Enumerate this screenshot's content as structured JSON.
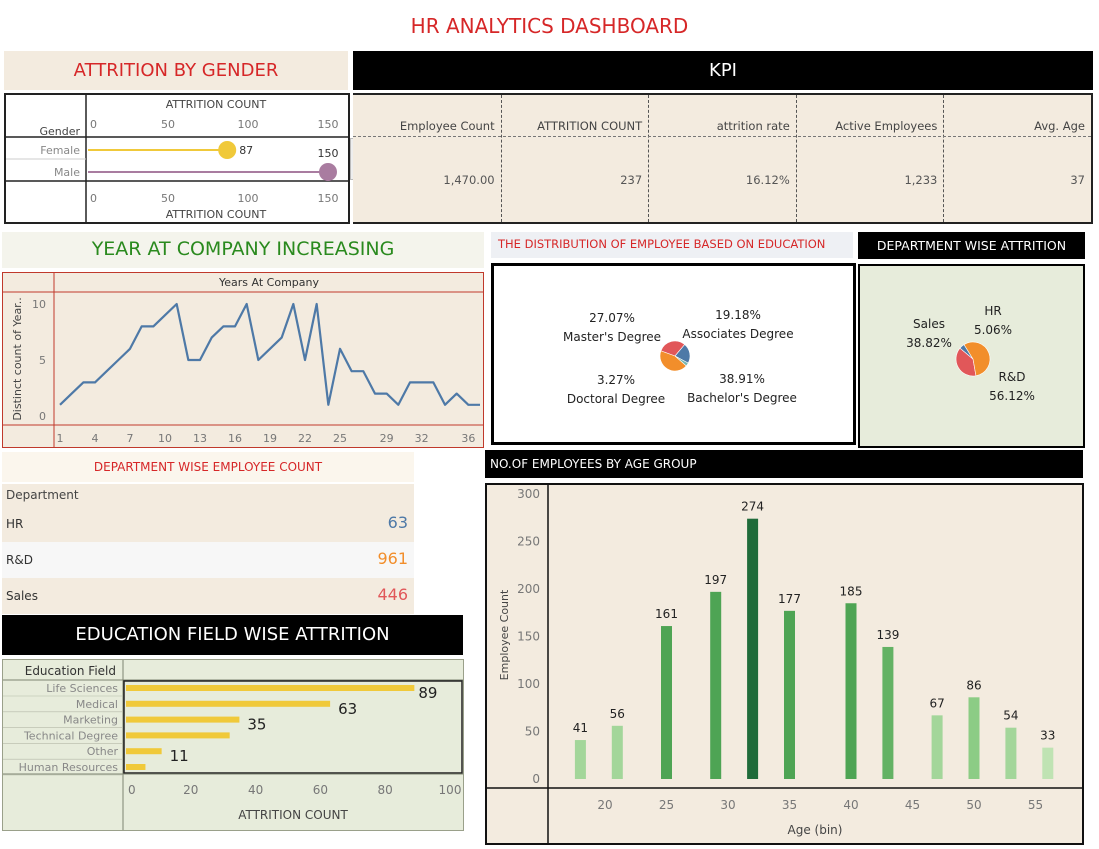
{
  "dashboard_title": "HR ANALYTICS DASHBOARD",
  "attrition_gender": {
    "title": "ATTRITION BY GENDER",
    "dim_label": "Gender",
    "axis_title": "ATTRITION COUNT",
    "ticks": [
      "0",
      "50",
      "100",
      "150"
    ],
    "rows": [
      {
        "label": "Female",
        "value": 87,
        "value_label": "87",
        "color": "#f0c93a"
      },
      {
        "label": "Male",
        "value": 150,
        "value_label": "150",
        "color": "#a97ca0"
      }
    ]
  },
  "kpi": {
    "title": "KPI",
    "items": [
      {
        "label": "Employee Count",
        "value": "1,470.00"
      },
      {
        "label": "ATTRITION COUNT",
        "value": "237"
      },
      {
        "label": "attrition rate",
        "value": "16.12%"
      },
      {
        "label": "Active Employees",
        "value": "1,233"
      },
      {
        "label": "Avg. Age",
        "value": "37"
      }
    ]
  },
  "years_chart": {
    "title": "YEAR AT COMPANY INCREASING",
    "header": "Years At Company",
    "ylabel": "Distinct count of Year..",
    "yticks": [
      "10",
      "5",
      "0"
    ],
    "xticks": [
      "1",
      "4",
      "7",
      "10",
      "13",
      "16",
      "19",
      "22",
      "25",
      "29",
      "32",
      "36"
    ],
    "line_color": "#4e79a7"
  },
  "education_dist": {
    "title": "THE DISTRIBUTION OF EMPLOYEE BASED ON EDUCATION",
    "slices": [
      {
        "pct": "27.07%",
        "label": "Master's Degree",
        "color": "#e15759"
      },
      {
        "pct": "19.18%",
        "label": "Associates Degree",
        "color": "#4e79a7"
      },
      {
        "pct": "3.27%",
        "label": "Doctoral Degree",
        "color": "#76b7b2"
      },
      {
        "pct": "38.91%",
        "label": "Bachelor's Degree",
        "color": "#f28e2b"
      }
    ]
  },
  "dept_attrition": {
    "title": "DEPARTMENT WISE ATTRITION",
    "slices": [
      {
        "name": "Sales",
        "pct": "38.82%",
        "color": "#e15759"
      },
      {
        "name": "HR",
        "pct": "5.06%",
        "color": "#4e79a7"
      },
      {
        "name": "R&D",
        "pct": "56.12%",
        "color": "#f28e2b"
      }
    ]
  },
  "dept_count": {
    "title": "DEPARTMENT WISE EMPLOYEE COUNT",
    "header": "Department",
    "rows": [
      {
        "name": "HR",
        "value": "63",
        "color": "#4e79a7"
      },
      {
        "name": "R&D",
        "value": "961",
        "color": "#f28e2b"
      },
      {
        "name": "Sales",
        "value": "446",
        "color": "#e15759"
      }
    ]
  },
  "edu_field": {
    "title": "EDUCATION FIELD WISE ATTRITION",
    "header": "Education Field",
    "axis_title": "ATTRITION COUNT",
    "ticks": [
      "0",
      "20",
      "40",
      "60",
      "80",
      "100"
    ],
    "bar_color": "#f0c93a",
    "rows": [
      {
        "label": "Life Sciences",
        "value": 89,
        "value_label": "89"
      },
      {
        "label": "Medical",
        "value": 63,
        "value_label": "63"
      },
      {
        "label": "Marketing",
        "value": 35,
        "value_label": "35"
      },
      {
        "label": "Technical Degree",
        "value": 32,
        "value_label": ""
      },
      {
        "label": "Other",
        "value": 11,
        "value_label": "11"
      },
      {
        "label": "Human Resources",
        "value": 6,
        "value_label": ""
      }
    ]
  },
  "age_group": {
    "title": "NO.OF EMPLOYEES BY AGE GROUP",
    "ylabel": "Employee Count",
    "xlabel": "Age (bin)",
    "yticks": [
      "300",
      "250",
      "200",
      "150",
      "100",
      "50",
      "0"
    ],
    "xticks": [
      "20",
      "25",
      "30",
      "35",
      "40",
      "45",
      "50",
      "55"
    ]
  },
  "chart_data": [
    {
      "type": "bar",
      "title": "ATTRITION BY GENDER",
      "categories": [
        "Female",
        "Male"
      ],
      "values": [
        87,
        150
      ],
      "xlabel": "ATTRITION COUNT",
      "xlim": [
        0,
        150
      ]
    },
    {
      "type": "line",
      "title": "YEAR AT COMPANY INCREASING",
      "xlabel": "Years At Company",
      "ylabel": "Distinct count of Year..",
      "x": [
        1,
        2,
        3,
        4,
        5,
        6,
        7,
        8,
        9,
        10,
        11,
        12,
        13,
        14,
        15,
        16,
        17,
        18,
        19,
        20,
        21,
        22,
        23,
        24,
        25,
        26,
        27,
        28,
        29,
        30,
        31,
        32,
        33,
        34,
        35,
        36,
        37
      ],
      "y": [
        1,
        2,
        3,
        3,
        4,
        5,
        6,
        8,
        8,
        9,
        10,
        5,
        5,
        7,
        8,
        8,
        10,
        5,
        6,
        7,
        10,
        5,
        10,
        1,
        6,
        4,
        4,
        2,
        2,
        1,
        3,
        3,
        3,
        1,
        2,
        1,
        1
      ],
      "ylim": [
        0,
        10
      ]
    },
    {
      "type": "pie",
      "title": "THE DISTRIBUTION OF EMPLOYEE BASED ON EDUCATION",
      "categories": [
        "Master's Degree",
        "Associates Degree",
        "Doctoral Degree",
        "Bachelor's Degree"
      ],
      "values": [
        27.07,
        19.18,
        3.27,
        38.91
      ]
    },
    {
      "type": "pie",
      "title": "DEPARTMENT WISE ATTRITION",
      "categories": [
        "Sales",
        "HR",
        "R&D"
      ],
      "values": [
        38.82,
        5.06,
        56.12
      ]
    },
    {
      "type": "table",
      "title": "DEPARTMENT WISE EMPLOYEE COUNT",
      "categories": [
        "HR",
        "R&D",
        "Sales"
      ],
      "values": [
        63,
        961,
        446
      ]
    },
    {
      "type": "bar",
      "title": "EDUCATION FIELD WISE ATTRITION",
      "categories": [
        "Life Sciences",
        "Medical",
        "Marketing",
        "Technical Degree",
        "Other",
        "Human Resources"
      ],
      "values": [
        89,
        63,
        35,
        32,
        11,
        6
      ],
      "xlabel": "ATTRITION COUNT",
      "xlim": [
        0,
        100
      ]
    },
    {
      "type": "bar",
      "title": "NO.OF EMPLOYEES BY AGE GROUP",
      "x": [
        18,
        21,
        25,
        29,
        32,
        35,
        40,
        43,
        47,
        50,
        53,
        56
      ],
      "values": [
        41,
        56,
        161,
        197,
        274,
        177,
        185,
        139,
        67,
        86,
        54,
        33
      ],
      "value_labels": [
        "41",
        "56",
        "161",
        "197",
        "274",
        "177",
        "185",
        "139",
        "67",
        "86",
        "54",
        "33"
      ],
      "colors": [
        "#a3d69a",
        "#a3d69a",
        "#4ea454",
        "#4ea454",
        "#1f6b3a",
        "#4ea454",
        "#4ea454",
        "#63b264",
        "#a3d69a",
        "#8ccc85",
        "#a3d69a",
        "#bfe3b3"
      ],
      "xlabel": "Age (bin)",
      "ylabel": "Employee Count",
      "ylim": [
        0,
        300
      ]
    }
  ]
}
